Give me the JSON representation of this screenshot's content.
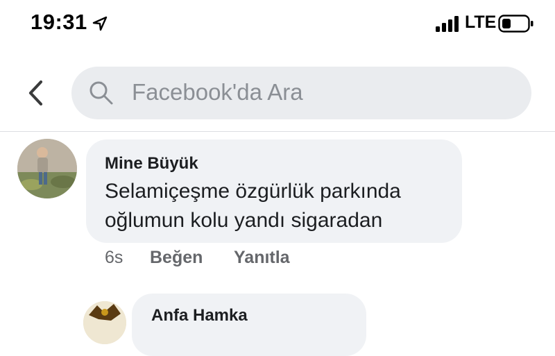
{
  "status_bar": {
    "time": "19:31",
    "network": "LTE",
    "icons": [
      "location-arrow-icon",
      "signal-bars-icon",
      "battery-icon"
    ]
  },
  "header": {
    "back_icon": "chevron-left-icon",
    "search": {
      "placeholder": "Facebook'da Ara",
      "icon": "search-icon"
    }
  },
  "comments": [
    {
      "author": "Mine Büyük",
      "text": "Selamiçeşme özgürlük parkında oğlumun kolu yandı sigaradan",
      "time": "6s",
      "actions": {
        "like": "Beğen",
        "reply": "Yanıtla"
      }
    },
    {
      "author": "Anfa Hamka",
      "text": ""
    }
  ],
  "colors": {
    "search_bg": "#eaecef",
    "bubble_bg": "#f0f2f5",
    "meta_text": "#65676b",
    "placeholder": "#8b8f95"
  }
}
